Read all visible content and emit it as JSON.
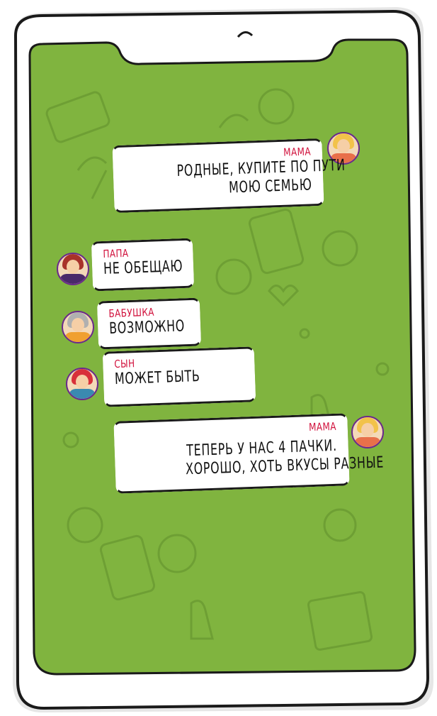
{
  "colors": {
    "screen": "#80b43f",
    "pattern": "#6a9a33",
    "name": "#d1113c",
    "outline": "#1a1a1a",
    "avatar_ring": "#6a2a8a"
  },
  "messages": [
    {
      "sender": "МАМА",
      "lines": [
        "РОДНЫЕ, КУПИТЕ ПО ПУТИ",
        "МОЮ СЕМЬЮ"
      ],
      "side": "right",
      "avatar": "mom-avatar"
    },
    {
      "sender": "ПАПА",
      "lines": [
        "НЕ ОБЕЩАЮ"
      ],
      "side": "left",
      "avatar": "dad-avatar"
    },
    {
      "sender": "БАБУШКА",
      "lines": [
        "ВОЗМОЖНО"
      ],
      "side": "left",
      "avatar": "grandma-avatar"
    },
    {
      "sender": "СЫН",
      "lines": [
        "МОЖЕТ БЫТЬ"
      ],
      "side": "left",
      "avatar": "son-avatar"
    },
    {
      "sender": "МАМА",
      "lines": [
        "ТЕПЕРЬ У НАС 4 ПАЧКИ.",
        "ХОРОШО, ХОТЬ ВКУСЫ РАЗНЫЕ"
      ],
      "side": "right",
      "avatar": "mom-avatar"
    }
  ]
}
